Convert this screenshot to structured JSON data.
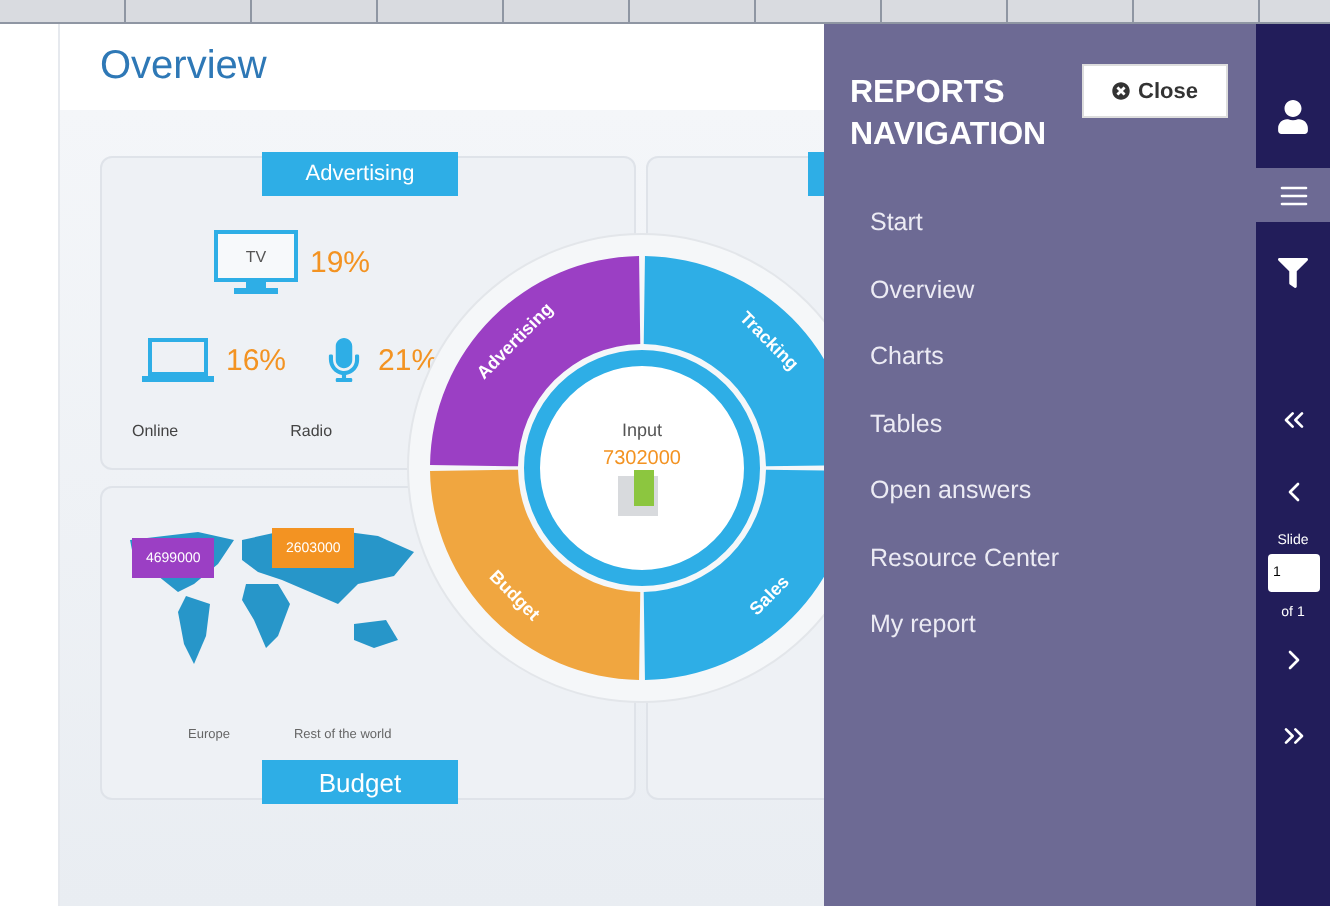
{
  "page": {
    "title": "Overview"
  },
  "dashboard": {
    "advertising_card": {
      "ribbon": "Advertising",
      "media": [
        {
          "kind": "tv",
          "screen_label": "TV",
          "value": "19%"
        },
        {
          "kind": "laptop",
          "value": "16%"
        },
        {
          "kind": "mic",
          "value": "21%"
        }
      ],
      "labels": [
        "Online",
        "Radio"
      ]
    },
    "budget_card": {
      "ribbon": "Budget",
      "badges": [
        {
          "value": "4699000",
          "color": "#9b3fc4"
        },
        {
          "value": "2603000",
          "color": "#f39322"
        }
      ],
      "labels": [
        "Europe",
        "Rest of the world"
      ]
    },
    "donut": {
      "center_label": "Input",
      "center_value": "7302000",
      "segments": [
        {
          "label": "Advertising",
          "color": "#9b3fc4"
        },
        {
          "label": "Tracking",
          "color": "#2eaee6"
        },
        {
          "label": "Sales",
          "color": "#2eaee6"
        },
        {
          "label": "Budget",
          "color": "#f0a640"
        }
      ]
    }
  },
  "navigation": {
    "title": "REPORTS NAVIGATION",
    "close_button": "Close",
    "items": [
      "Start",
      "Overview",
      "Charts",
      "Tables",
      "Open answers",
      "Resource Center",
      "My report"
    ]
  },
  "toolbar": {
    "tools": [
      {
        "kind": "user",
        "selected": false
      },
      {
        "kind": "menu",
        "selected": true
      },
      {
        "kind": "filter",
        "selected": false
      }
    ],
    "slide_label": "Slide",
    "slide_value": "1",
    "slide_total": "of 1"
  }
}
